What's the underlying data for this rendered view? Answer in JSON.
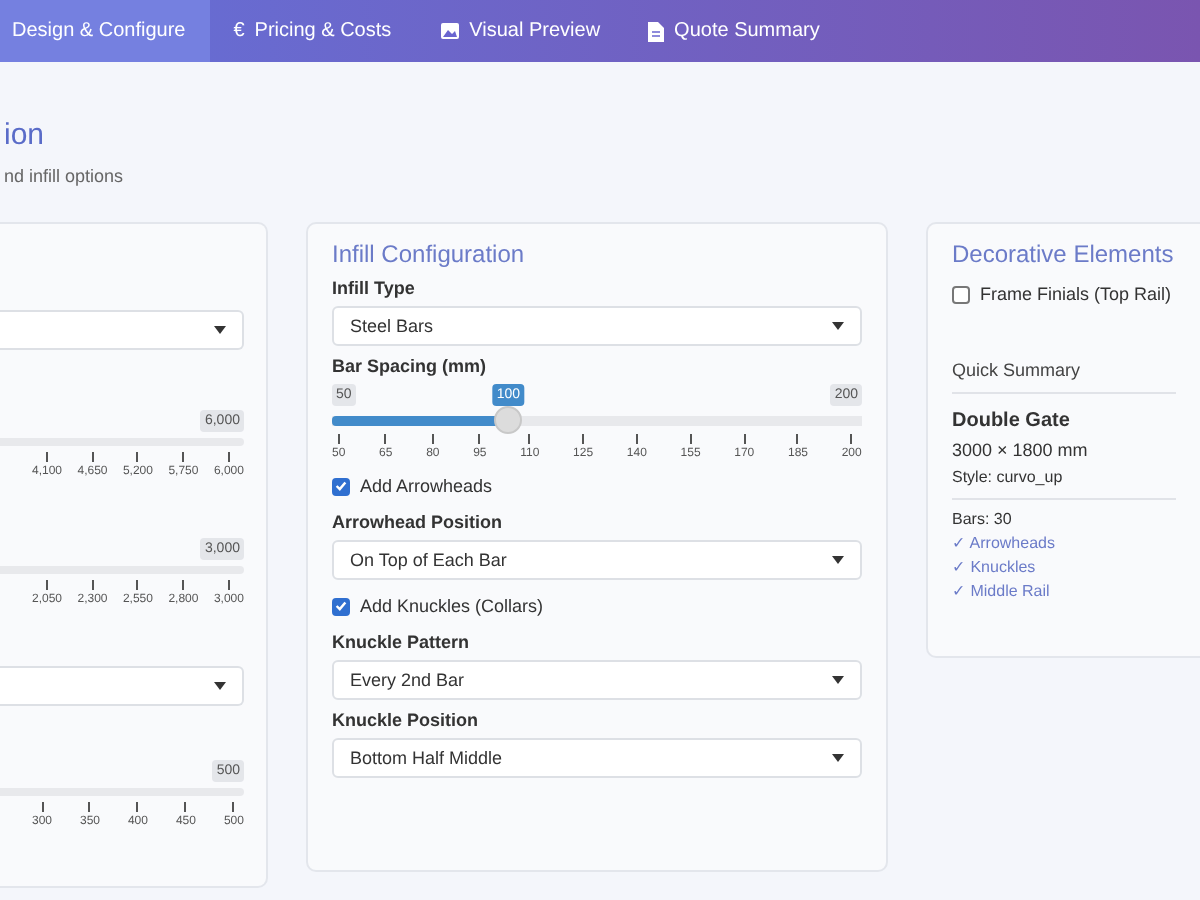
{
  "nav": {
    "tabs": [
      {
        "label": "Design & Configure",
        "kind": "text",
        "selected": true
      },
      {
        "label": "Pricing & Costs",
        "kind": "glyph",
        "icon": "€",
        "selected": false
      },
      {
        "label": "Visual Preview",
        "kind": "image",
        "selected": false
      },
      {
        "label": "Quote Summary",
        "kind": "document",
        "selected": false
      }
    ]
  },
  "header": {
    "title": "ion",
    "subtitle": "nd infill options"
  },
  "left_card": {
    "controls": [
      {
        "kind": "select"
      },
      {
        "kind": "slider",
        "max_label": "6,000",
        "ticks": [
          "4,100",
          "4,650",
          "5,200",
          "5,750",
          "6,000"
        ]
      },
      {
        "kind": "slider",
        "max_label": "3,000",
        "ticks": [
          "2,050",
          "2,300",
          "2,550",
          "2,800",
          "3,000"
        ]
      },
      {
        "kind": "select"
      },
      {
        "kind": "slider",
        "max_label": "500",
        "ticks": [
          "300",
          "350",
          "400",
          "450",
          "500"
        ]
      }
    ]
  },
  "infill": {
    "title": "Infill Configuration",
    "controls": [
      {
        "kind": "select",
        "label": "Infill Type",
        "value": "Steel Bars"
      },
      {
        "kind": "slider",
        "label": "Bar Spacing (mm)",
        "min_label": "50",
        "value_label": "100",
        "max_label": "200",
        "level": 0.333,
        "ticks": [
          "50",
          "65",
          "80",
          "95",
          "110",
          "125",
          "140",
          "155",
          "170",
          "185",
          "200"
        ]
      },
      {
        "kind": "checkbox",
        "label": "Add Arrowheads",
        "checked": true
      },
      {
        "kind": "select",
        "label": "Arrowhead Position",
        "value": "On Top of Each Bar"
      },
      {
        "kind": "checkbox",
        "label": "Add Knuckles (Collars)",
        "checked": true
      },
      {
        "kind": "select",
        "label": "Knuckle Pattern",
        "value": "Every 2nd Bar"
      },
      {
        "kind": "select",
        "label": "Knuckle Position",
        "value": "Bottom Half Middle"
      }
    ]
  },
  "decorative": {
    "title": "Decorative Elements",
    "checkbox": {
      "label": "Frame Finials (Top Rail)",
      "checked": false
    },
    "summary": {
      "heading": "Quick Summary",
      "name": "Double Gate",
      "size": "3000 × 1800 mm",
      "style": "Style: curvo_up",
      "bars": "Bars: 30",
      "features": [
        "✓ Arrowheads",
        "✓ Knuckles",
        "✓ Middle Rail"
      ]
    }
  }
}
